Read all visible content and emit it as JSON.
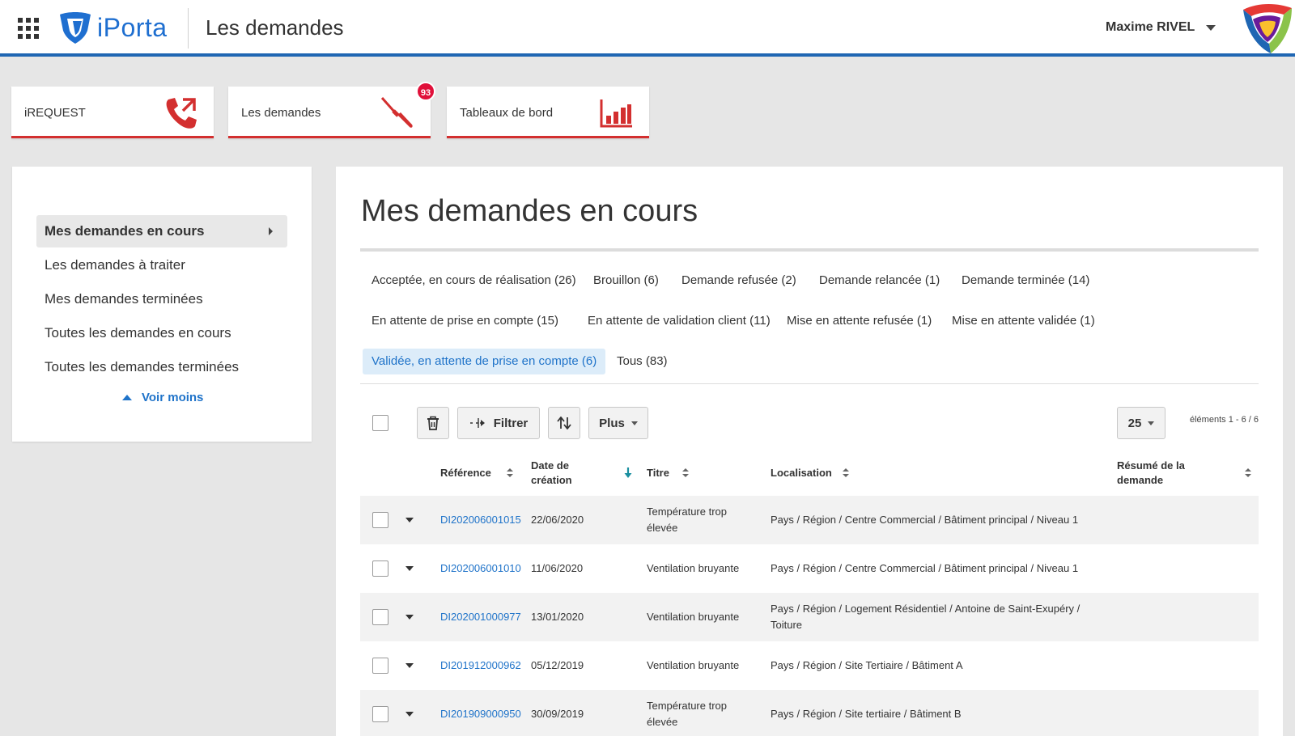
{
  "header": {
    "logo_text": "iPorta",
    "title": "Les demandes",
    "user_name": "Maxime RIVEL",
    "apps_icon": "grid-icon",
    "brand_color": "#1f66b3"
  },
  "tiles": [
    {
      "label": "iREQUEST",
      "icon": "phone-forward-icon"
    },
    {
      "label": "Les demandes",
      "icon": "screwdriver-icon",
      "badge": "93"
    },
    {
      "label": "Tableaux de bord",
      "icon": "bar-chart-icon"
    }
  ],
  "sidebar": {
    "items": [
      {
        "label": "Mes demandes en cours",
        "active": true
      },
      {
        "label": "Les demandes à traiter"
      },
      {
        "label": "Mes demandes terminées"
      },
      {
        "label": "Toutes les demandes en cours"
      },
      {
        "label": "Toutes les demandes terminées"
      }
    ],
    "toggle_label": "Voir moins"
  },
  "main": {
    "title": "Mes demandes en cours",
    "status_filters": [
      "Acceptée, en cours de réalisation (26)",
      "Brouillon (6)",
      "Demande refusée (2)",
      "Demande relancée (1)",
      "Demande terminée (14)",
      "En attente de prise en compte (15)",
      "En attente de validation client (11)",
      "Mise en attente refusée (1)",
      "Mise en attente validée (1)",
      "Validée, en attente de prise en compte (6)",
      "Tous (83)"
    ],
    "selected_filter": "Validée, en attente de prise en compte (6)",
    "toolbar": {
      "filter_label": "Filtrer",
      "more_label": "Plus",
      "page_size": "25",
      "range_text": "éléments 1 - 6 / 6"
    },
    "table": {
      "columns": [
        "Référence",
        "Date de création",
        "Titre",
        "Localisation",
        "Résumé de la demande"
      ],
      "rows": [
        {
          "ref": "DI202006001015",
          "date": "22/06/2020",
          "titre": "Température trop élevée",
          "localisation": "Pays / Région / Centre Commercial / Bâtiment principal / Niveau 1",
          "resume": ""
        },
        {
          "ref": "DI202006001010",
          "date": "11/06/2020",
          "titre": "Ventilation bruyante",
          "localisation": "Pays / Région / Centre Commercial / Bâtiment principal / Niveau 1",
          "resume": ""
        },
        {
          "ref": "DI202001000977",
          "date": "13/01/2020",
          "titre": "Ventilation bruyante",
          "localisation": "Pays / Région / Logement Résidentiel / Antoine de Saint-Exupéry / Toiture",
          "resume": ""
        },
        {
          "ref": "DI201912000962",
          "date": "05/12/2019",
          "titre": "Ventilation bruyante",
          "localisation": "Pays / Région / Site Tertiaire / Bâtiment A",
          "resume": ""
        },
        {
          "ref": "DI201909000950",
          "date": "30/09/2019",
          "titre": "Température trop élevée",
          "localisation": "Pays / Région / Site tertiaire / Bâtiment B",
          "resume": ""
        }
      ]
    }
  }
}
